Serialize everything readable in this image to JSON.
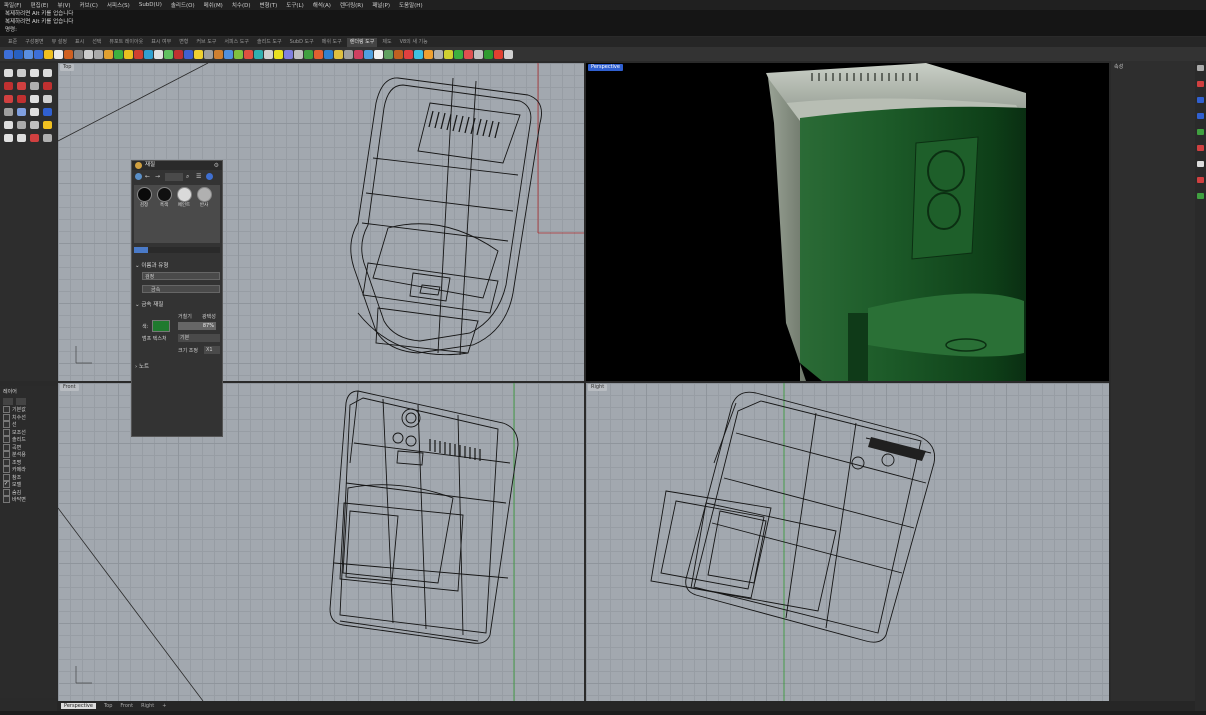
{
  "menu": {
    "items": [
      "파일(F)",
      "편집(E)",
      "뷰(V)",
      "커브(C)",
      "서피스(S)",
      "SubD(U)",
      "솔리드(O)",
      "메쉬(M)",
      "치수(D)",
      "변형(T)",
      "도구(L)",
      "해석(A)",
      "렌더링(R)",
      "패널(P)",
      "도움말(H)"
    ]
  },
  "command_history": {
    "line1": "복제하려면 Alt 키를 업습니다",
    "line2": "복제하려면 Alt 키를 업습니다",
    "prompt": "명령:"
  },
  "toolbar_tabs": {
    "items": [
      {
        "label": "표준",
        "active": false
      },
      {
        "label": "구성평면",
        "active": false
      },
      {
        "label": "뷰 설정",
        "active": false
      },
      {
        "label": "표시",
        "active": false
      },
      {
        "label": "선택",
        "active": false
      },
      {
        "label": "뷰포트 레이아웃",
        "active": false
      },
      {
        "label": "표시 여부",
        "active": false
      },
      {
        "label": "변형",
        "active": false
      },
      {
        "label": "커브 도구",
        "active": false
      },
      {
        "label": "서피스 도구",
        "active": false
      },
      {
        "label": "솔리드 도구",
        "active": false
      },
      {
        "label": "SubD 도구",
        "active": false
      },
      {
        "label": "메쉬 도구",
        "active": false
      },
      {
        "label": "렌더링 도구",
        "active": true
      },
      {
        "label": "제도",
        "active": false
      },
      {
        "label": "V8의 새 기능",
        "active": false
      }
    ]
  },
  "viewports": {
    "top": {
      "label": "Top"
    },
    "perspective": {
      "label": "Perspective"
    },
    "front": {
      "label": "Front"
    },
    "right": {
      "label": "Right"
    }
  },
  "material_panel": {
    "title": "재질",
    "swatches": [
      "검정",
      "흑색",
      "페인트",
      "반사"
    ],
    "section_name": "이름과 유형",
    "name_value": "검정",
    "type_value": "금속",
    "section_metal": "금속 재질",
    "color_label": "색:",
    "roughness_label": "거칠기",
    "polish_label": "광택성",
    "polish_value": "87%",
    "texture_label": "범프 텍스처",
    "texture_value": "기본",
    "size_label": "크기 조정",
    "size_value": "X1",
    "notes_label": "노트",
    "colors": {
      "metal": "#1f7a2e"
    }
  },
  "layers": {
    "header": "레이어",
    "items": [
      {
        "name": "기본값",
        "checked": false
      },
      {
        "name": "치수선",
        "checked": false
      },
      {
        "name": "선",
        "checked": false
      },
      {
        "name": "보조선",
        "checked": false
      },
      {
        "name": "솔리드",
        "checked": false
      },
      {
        "name": "곡면",
        "checked": false
      },
      {
        "name": "분석용",
        "checked": false
      },
      {
        "name": "조명",
        "checked": false
      },
      {
        "name": "카메라",
        "checked": false
      },
      {
        "name": "참조",
        "checked": false
      },
      {
        "name": "모델",
        "checked": true
      },
      {
        "name": "숨김",
        "checked": false
      },
      {
        "name": "바닥면",
        "checked": false
      }
    ]
  },
  "right_panel": {
    "title": "속성"
  },
  "bottom_tabs": {
    "items": [
      {
        "label": "Perspective",
        "active": true
      },
      {
        "label": "Top",
        "active": false
      },
      {
        "label": "Front",
        "active": false
      },
      {
        "label": "Right",
        "active": false
      },
      {
        "label": "+",
        "active": false
      }
    ]
  }
}
